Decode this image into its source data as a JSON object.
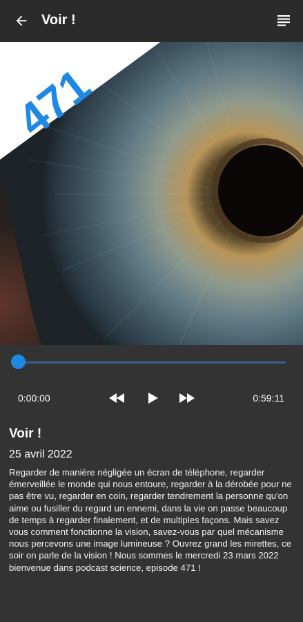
{
  "appbar": {
    "title": "Voir !",
    "back_icon": "arrow-left-icon",
    "menu_icon": "list-icon"
  },
  "cover": {
    "badge_text": "471",
    "badge_color": "#1e88e5",
    "badge_background": "#ffffff"
  },
  "player": {
    "current_time": "0:00:00",
    "total_time": "0:59:11",
    "progress": 0,
    "accent": "#1e88e5",
    "controls": [
      "rewind-icon",
      "play-icon",
      "fast-forward-icon"
    ]
  },
  "episode": {
    "title": "Voir !",
    "date": "25 avril 2022",
    "description": "Regarder de manière négligée un écran de téléphone, regarder émerveillée le monde qui nous entoure, regarder à la dérobée pour ne pas être vu, regarder en coin, regarder tendrement la personne qu'on aime ou fusiller du regard un ennemi, dans la vie on passe beaucoup de temps à regarder finalement, et de multiples façons. Mais savez vous comment fonctionne la vision, savez-vous par quel mécanisme nous percevons une image lumineuse ? Ouvrez grand les mirettes, ce soir on parle de la vision ! Nous sommes le mercredi 23 mars 2022 bienvenue dans podcast science, episode 471 !"
  }
}
